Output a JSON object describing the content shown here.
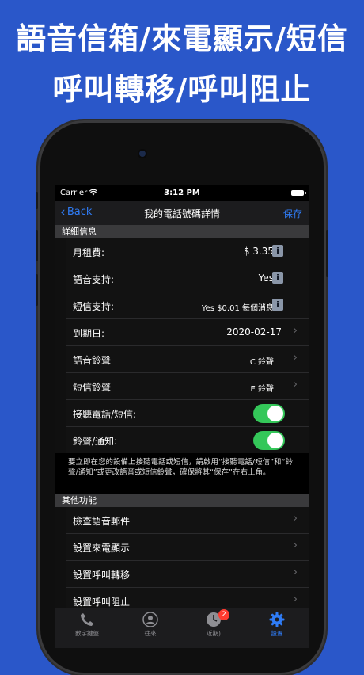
{
  "headline": {
    "line1": "語音信箱/來電顯示/短信",
    "line2": "呼叫轉移/呼叫阻止"
  },
  "status": {
    "carrier": "Carrier",
    "time": "3:12 PM"
  },
  "nav": {
    "back": "Back",
    "title": "我的電話號碼詳情",
    "save": "保存"
  },
  "details": {
    "header": "詳細信息",
    "rent_label": "月租費:",
    "rent_value": "$ 3.35",
    "voice_label": "語音支持:",
    "voice_value": "Yes",
    "sms_label": "短信支持:",
    "sms_value": "Yes $0.01 每個消息",
    "expiry_label": "到期日:",
    "expiry_value": "2020-02-17",
    "voice_ring_label": "語音鈴聲",
    "voice_ring_value": "C 鈴聲",
    "sms_ring_label": "短信鈴聲",
    "sms_ring_value": "E 鈴聲",
    "answer_label": "接聽電話/短信:",
    "notify_label": "鈴聲/通知:",
    "footnote": "要立即在您的設備上接聽電話或短信，請啟用“接聽電話/短信”和“鈴聲/通知”或更改語音或短信鈴聲，確保將其“保存”在右上角。"
  },
  "other": {
    "header": "其他功能",
    "item1": "檢查語音郵件",
    "item2": "設置來電顯示",
    "item3": "設置呼叫轉移",
    "item4": "設置呼叫阻止"
  },
  "tabs": {
    "dialpad": "數字鍵盤",
    "contacts": "往來",
    "recents": "近期)",
    "recents_badge": "2",
    "settings": "設置"
  },
  "colors": {
    "accent": "#2f7cf6",
    "toggle_on": "#34c759",
    "background": "#2a57c9"
  }
}
